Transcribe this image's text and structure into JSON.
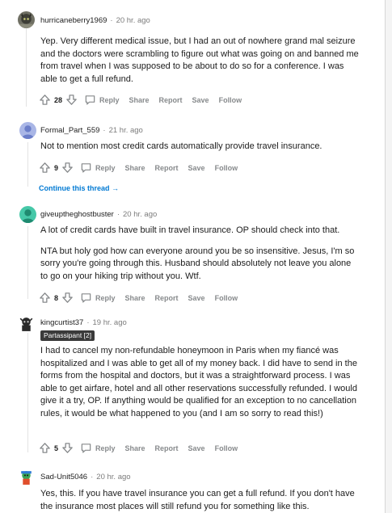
{
  "comments": [
    {
      "username": "hurricaneberry1969",
      "time": "20 hr. ago",
      "paragraphs": [
        "Yep. Very different medical issue, but I had an out of nowhere grand mal seizure and the doctors were scrambling to figure out what was going on and banned me from travel when I was supposed to be about to do so for a conference. I was able to get a full refund."
      ],
      "votes": "28"
    },
    {
      "username": "Formal_Part_559",
      "time": "21 hr. ago",
      "paragraphs": [
        "Not to mention most credit cards automatically provide travel insurance."
      ],
      "votes": "9"
    },
    {
      "username": "giveuptheghostbuster",
      "time": "20 hr. ago",
      "paragraphs": [
        "A lot of credit cards have built in travel insurance. OP should check into that.",
        "NTA but holy god how can everyone around you be so insensitive. Jesus, I'm so sorry you're going through this. Husband should absolutely not leave you alone to go on your hiking trip without you. Wtf."
      ],
      "votes": "8"
    },
    {
      "username": "kingcurtist37",
      "time": "19 hr. ago",
      "flair": "Partassipant [2]",
      "paragraphs": [
        "I had to cancel my non-refundable honeymoon in Paris when my fiancé was hospitalized and I was able to get all of my money back. I did have to send in the forms from the hospital and doctors, but it was a straightforward process. I was able to get airfare, hotel and all other reservations successfully refunded. I would give it a try, OP. If anything would be qualified for an exception to no cancellation rules, it would be what happened to you (and I am so sorry to read this!)"
      ],
      "votes": "5"
    },
    {
      "username": "Sad-Unit5046",
      "time": "20 hr. ago",
      "paragraphs": [
        "Yes, this. If you have travel insurance you can get a full refund. If you don't have the insurance most places will still refund you for something like this."
      ]
    }
  ],
  "actions": {
    "reply": "Reply",
    "share": "Share",
    "report": "Report",
    "save": "Save",
    "follow": "Follow"
  },
  "continue_thread": "Continue this thread →",
  "colors": {
    "link_blue": "#0079d3",
    "meta_gray": "#878a8c",
    "flair_bg": "#3a3a3a"
  },
  "icons": [
    "upvote-icon",
    "downvote-icon",
    "reply-icon"
  ]
}
